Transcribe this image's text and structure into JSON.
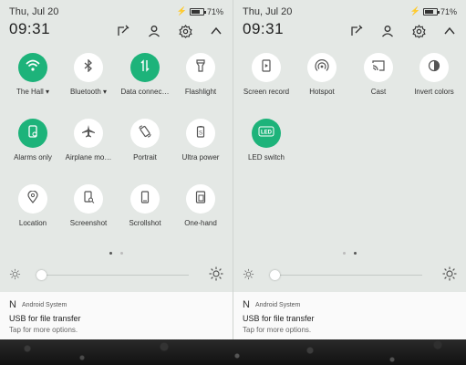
{
  "status": {
    "date": "Thu, Jul 20",
    "battery": "71%",
    "battery_fill": 0.71
  },
  "header": {
    "time": "09:31",
    "icons": [
      "edit-icon",
      "user-icon",
      "gear-icon",
      "chevron-up-icon"
    ]
  },
  "panel1": {
    "tiles": [
      {
        "label": "The Hall ▾",
        "icon": "wifi-icon",
        "on": true
      },
      {
        "label": "Bluetooth ▾",
        "icon": "bluetooth-icon",
        "on": false
      },
      {
        "label": "Data connec…",
        "icon": "data-icon",
        "on": true
      },
      {
        "label": "Flashlight",
        "icon": "flashlight-icon",
        "on": false
      },
      {
        "label": "Alarms only",
        "icon": "alarm-icon",
        "on": true
      },
      {
        "label": "Airplane mo…",
        "icon": "airplane-icon",
        "on": false
      },
      {
        "label": "Portrait",
        "icon": "rotate-icon",
        "on": false
      },
      {
        "label": "Ultra power",
        "icon": "power-save-icon",
        "on": false
      },
      {
        "label": "Location",
        "icon": "location-icon",
        "on": false
      },
      {
        "label": "Screenshot",
        "icon": "screenshot-icon",
        "on": false
      },
      {
        "label": "Scrollshot",
        "icon": "scrollshot-icon",
        "on": false
      },
      {
        "label": "One-hand",
        "icon": "one-hand-icon",
        "on": false
      }
    ],
    "page_index": 0
  },
  "panel2": {
    "tiles": [
      {
        "label": "Screen record",
        "icon": "record-icon",
        "on": false
      },
      {
        "label": "Hotspot",
        "icon": "hotspot-icon",
        "on": false
      },
      {
        "label": "Cast",
        "icon": "cast-icon",
        "on": false
      },
      {
        "label": "Invert colors",
        "icon": "invert-icon",
        "on": false
      },
      {
        "label": "LED switch",
        "icon": "led-icon",
        "on": true
      }
    ],
    "page_index": 1
  },
  "brightness": {
    "level": 0.0
  },
  "notification": {
    "app_icon": "N",
    "app_name": "Android System",
    "title": "USB for file transfer",
    "subtitle": "Tap for more options."
  },
  "colors": {
    "accent": "#1db37a",
    "panel_bg": "#e4e8e5",
    "notif_bg": "#fafafa"
  }
}
